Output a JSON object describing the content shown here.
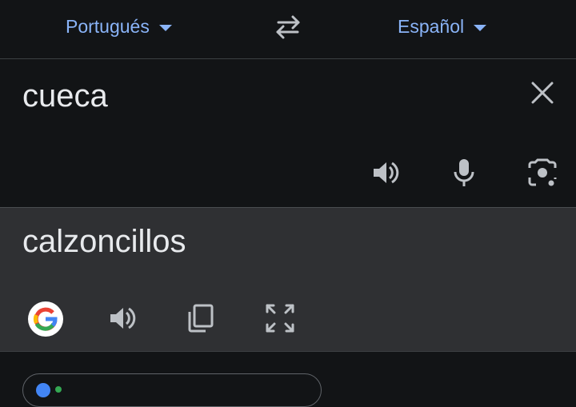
{
  "header": {
    "source_language": "Portugués",
    "target_language": "Español"
  },
  "input": {
    "text": "cueca"
  },
  "output": {
    "text": "calzoncillos"
  },
  "colors": {
    "accent": "#8ab4f8",
    "background": "#121416",
    "output_background": "#2f3033",
    "text": "#e8eaed",
    "icon": "#bdc1c6"
  },
  "icons": {
    "swap": "swap-languages-icon",
    "clear": "close-icon",
    "listen_source": "speaker-icon",
    "voice_input": "microphone-icon",
    "camera_input": "camera-icon",
    "google": "google-logo",
    "listen_translation": "speaker-icon",
    "copy": "copy-icon",
    "fullscreen": "fullscreen-icon"
  }
}
